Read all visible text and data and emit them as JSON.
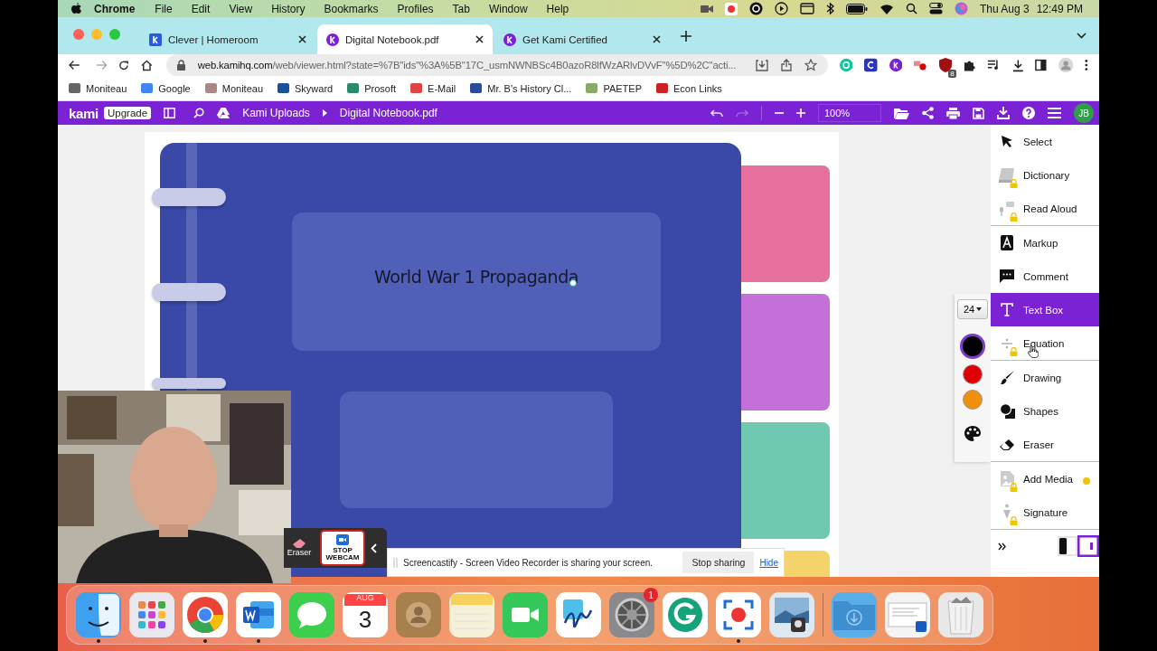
{
  "menu_bar": {
    "app": "Chrome",
    "items": [
      "File",
      "Edit",
      "View",
      "History",
      "Bookmarks",
      "Profiles",
      "Tab",
      "Window",
      "Help"
    ],
    "date": "Thu Aug 3",
    "time": "12:49 PM"
  },
  "tabs": [
    {
      "title": "Clever | Homeroom",
      "selected": false
    },
    {
      "title": "Digital Notebook.pdf",
      "selected": true
    },
    {
      "title": "Get Kami Certified",
      "selected": false
    }
  ],
  "address_bar": {
    "host": "web.kamihq.com",
    "path": "/web/viewer.html?state=%7B\"ids\"%3A%5B\"17C_usmNWNBSc4B0azoR8lfWzARlvDVvF\"%5D%2C\"acti...",
    "extension_badge": "8"
  },
  "bookmarks": [
    "Moniteau",
    "Google",
    "Moniteau",
    "Skyward",
    "Prosoft",
    "E-Mail",
    "Mr. B's History Cl...",
    "PAETEP",
    "Econ Links"
  ],
  "kami_toolbar": {
    "logo": "kami",
    "upgrade": "Upgrade",
    "breadcrumb": [
      "Kami Uploads",
      "Digital Notebook.pdf"
    ],
    "zoom": "100%",
    "redo_disabled": true,
    "avatar": "JB"
  },
  "document": {
    "title": "World War 1 Propaganda"
  },
  "text_options": {
    "font_size": "24",
    "colors": [
      {
        "color": "#000000",
        "selected": true
      },
      {
        "color": "#e00000",
        "selected": false
      },
      {
        "color": "#f0900a",
        "selected": false
      }
    ]
  },
  "tool_groups": [
    {
      "tools": [
        {
          "label": "Select",
          "kind": "select",
          "locked": false,
          "selected": false
        },
        {
          "label": "Dictionary",
          "kind": "dictionary",
          "locked": true,
          "selected": false
        },
        {
          "label": "Read Aloud",
          "kind": "read_aloud",
          "locked": true,
          "selected": false
        }
      ]
    },
    {
      "tools": [
        {
          "label": "Markup",
          "kind": "markup",
          "locked": false,
          "selected": false
        },
        {
          "label": "Comment",
          "kind": "comment",
          "locked": false,
          "selected": false
        },
        {
          "label": "Text Box",
          "kind": "text",
          "locked": false,
          "selected": true
        },
        {
          "label": "Equation",
          "kind": "equation",
          "locked": true,
          "selected": false
        }
      ]
    },
    {
      "tools": [
        {
          "label": "Drawing",
          "kind": "drawing",
          "locked": false,
          "selected": false
        },
        {
          "label": "Shapes",
          "kind": "shapes",
          "locked": false,
          "selected": false
        },
        {
          "label": "Eraser",
          "kind": "eraser",
          "locked": false,
          "selected": false
        }
      ]
    },
    {
      "tools": [
        {
          "label": "Add Media",
          "kind": "media",
          "locked": true,
          "selected": false,
          "notification": true
        },
        {
          "label": "Signature",
          "kind": "signature",
          "locked": true,
          "selected": false
        }
      ]
    }
  ],
  "webcam_toolbar": {
    "eraser": "Eraser",
    "stop_webcam": "STOP WEBCAM"
  },
  "share_bar": {
    "message": "Screencastify - Screen Video Recorder is sharing your screen.",
    "stop": "Stop sharing",
    "hide": "Hide"
  },
  "dock": {
    "apps": [
      {
        "kind": "finder",
        "running": true
      },
      {
        "kind": "launchpad",
        "running": false
      },
      {
        "kind": "chrome",
        "running": true
      },
      {
        "kind": "word",
        "running": true
      },
      {
        "kind": "messages",
        "running": false
      },
      {
        "kind": "calendar",
        "running": false,
        "month": "AUG",
        "day": "3"
      },
      {
        "kind": "contacts",
        "running": false
      },
      {
        "kind": "notes",
        "running": false
      },
      {
        "kind": "facetime",
        "running": false
      },
      {
        "kind": "freeform",
        "running": false
      },
      {
        "kind": "settings",
        "running": false,
        "badge": "1"
      },
      {
        "kind": "grammarly",
        "running": false
      },
      {
        "kind": "screencastify",
        "running": true
      },
      {
        "kind": "preview",
        "running": false
      }
    ],
    "others": [
      {
        "kind": "downloads",
        "running": false
      },
      {
        "kind": "window",
        "running": false
      },
      {
        "kind": "trash",
        "running": false
      }
    ]
  }
}
